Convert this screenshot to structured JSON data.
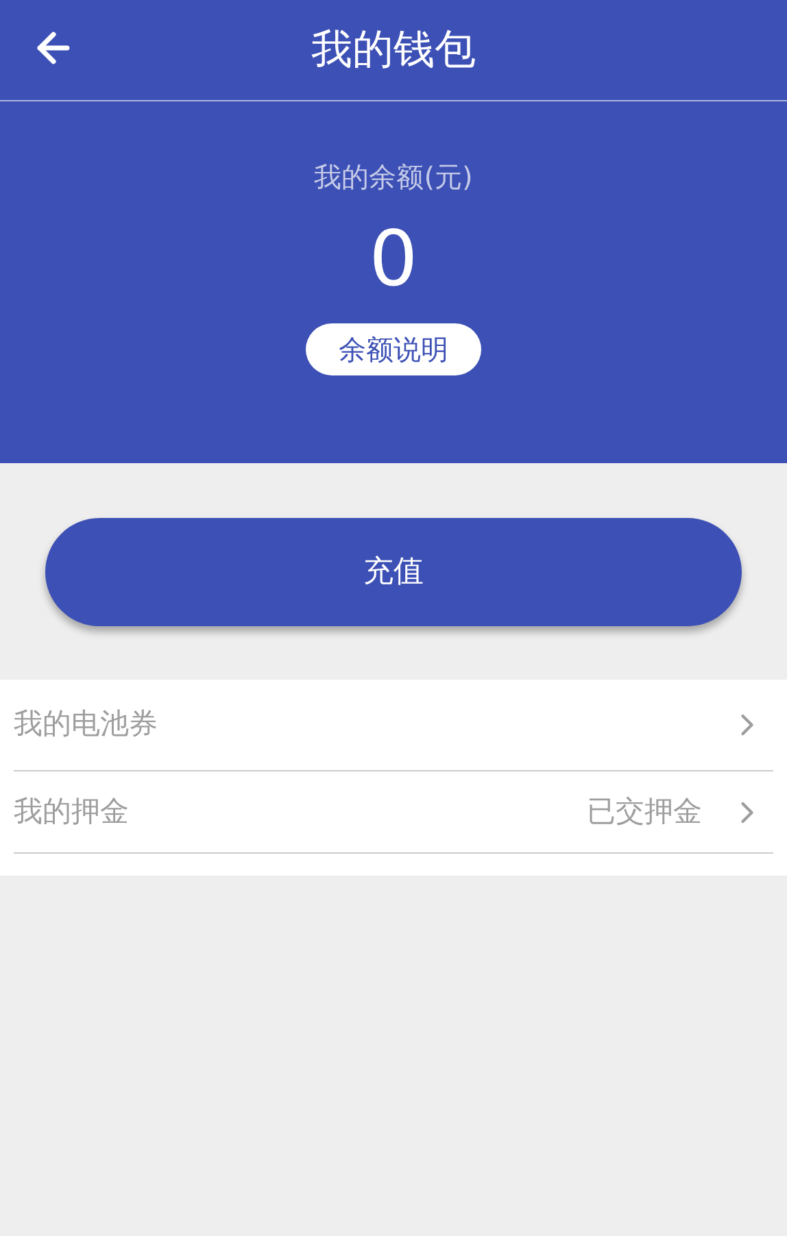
{
  "header": {
    "title": "我的钱包"
  },
  "balance": {
    "label": "我的余额(元)",
    "amount": "0",
    "info_button": "余额说明"
  },
  "recharge_button": "充值",
  "menu": [
    {
      "label": "我的电池券"
    },
    {
      "label": "我的押金",
      "value": "已交押金"
    }
  ]
}
